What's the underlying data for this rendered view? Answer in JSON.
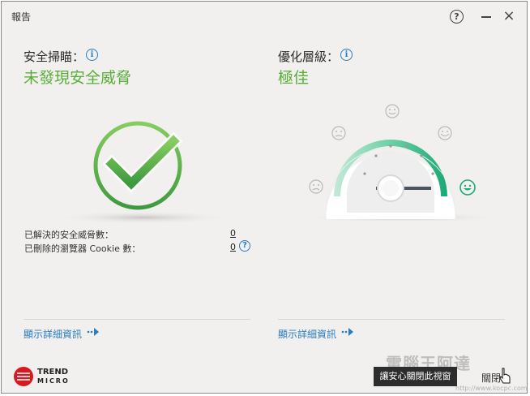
{
  "window": {
    "title": "報告",
    "help": "?",
    "close": "×"
  },
  "scan": {
    "title": "安全掃瞄：",
    "status": "未發現安全威脅",
    "stats": [
      {
        "label": "已解決的安全威脅數：",
        "value": "0"
      },
      {
        "label": "已刪除的瀏覽器 Cookie 數：",
        "value": "0"
      }
    ],
    "details_link": "顯示詳細資訊"
  },
  "optimize": {
    "title": "優化層級：",
    "status": "極佳",
    "level_fraction": 1.0,
    "details_link": "顯示詳細資訊"
  },
  "brand": {
    "line1": "TREND",
    "line2": "MICRO"
  },
  "tooltip": "讓安心關閉此視窗",
  "close_button": "關閉",
  "watermark": {
    "text": "電腦王阿達",
    "url": "http://www.kocpc.com.tw"
  },
  "colors": {
    "accent": "#2a7cc0",
    "ok_green": "#5aad3a",
    "brand_red": "#d71920"
  },
  "icons": [
    "info-icon",
    "help-icon",
    "minimize-icon",
    "close-icon",
    "checkmark-icon",
    "gauge-icon",
    "smiley-icon",
    "arrow-right-icon",
    "cursor-icon"
  ]
}
